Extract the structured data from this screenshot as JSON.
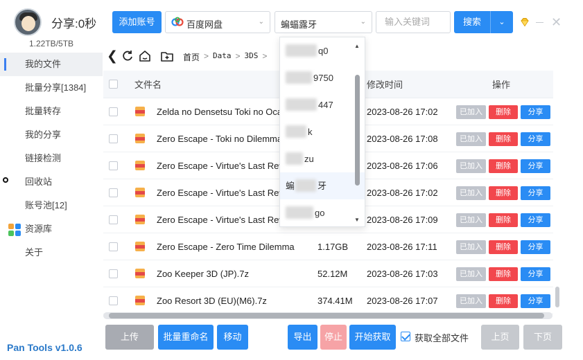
{
  "header": {
    "share_title": "分享:0秒",
    "storage": "1.22TB/5TB",
    "add_account_label": "添加账号",
    "pan_select_value": "百度网盘",
    "account_select_value": "蝙蝠露牙",
    "search_placeholder": "输入关键词",
    "search_label": "搜索"
  },
  "sidebar": {
    "items": [
      {
        "label": "我的文件",
        "active": true
      },
      {
        "label": "批量分享[1384]"
      },
      {
        "label": "批量转存"
      },
      {
        "label": "我的分享"
      },
      {
        "label": "链接检测"
      },
      {
        "label": "回收站"
      },
      {
        "label": "账号池[12]"
      },
      {
        "label": "资源库"
      },
      {
        "label": "关于"
      }
    ],
    "version": "Pan Tools v1.0.6"
  },
  "breadcrumb": {
    "home": "首页",
    "path": [
      "Data",
      "3DS"
    ]
  },
  "table": {
    "headers": {
      "name": "文件名",
      "time": "修改时间",
      "op": "操作"
    },
    "op_labels": {
      "added": "已加入",
      "delete": "删除",
      "share": "分享"
    },
    "rows": [
      {
        "name": "Zelda no Densetsu Toki no Ocarina 3D",
        "size": "",
        "time": "2023-08-26 17:02"
      },
      {
        "name": "Zero Escape - Toki no Dilemma",
        "size": "",
        "time": "2023-08-26 17:08"
      },
      {
        "name": "Zero Escape - Virtue's Last Reward",
        "size": "",
        "time": "2023-08-26 17:06"
      },
      {
        "name": "Zero Escape - Virtue's Last Reward",
        "size": "",
        "time": "2023-08-26 17:02"
      },
      {
        "name": "Zero Escape - Virtue's Last Reward",
        "size": "",
        "time": "2023-08-26 17:09"
      },
      {
        "name": "Zero Escape - Zero Time Dilemma",
        "size": "1.17GB",
        "time": "2023-08-26 17:11"
      },
      {
        "name": "Zoo Keeper 3D (JP).7z",
        "size": "52.12M",
        "time": "2023-08-26 17:03"
      },
      {
        "name": "Zoo Resort 3D (EU)(M6).7z",
        "size": "374.41M",
        "time": "2023-08-26 17:07"
      }
    ]
  },
  "dropdown": {
    "items": [
      {
        "visible_tail": "q0"
      },
      {
        "visible_tail": "9750"
      },
      {
        "visible_tail": "447"
      },
      {
        "visible_tail": "k"
      },
      {
        "visible_tail": "zu"
      },
      {
        "visible_head": "蝙",
        "visible_tail": "牙",
        "highlighted": true
      },
      {
        "visible_tail": "go"
      }
    ]
  },
  "bottom": {
    "upload": "上传",
    "batch_rename": "批量重命名",
    "move": "移动",
    "export": "导出",
    "stop": "停止",
    "start_fetch": "开始获取",
    "fetch_all_label": "获取全部文件",
    "fetch_all_checked": true,
    "prev": "上页",
    "next": "下页"
  },
  "colors": {
    "accent": "#2a8cf4",
    "danger": "#f2474d",
    "disabled": "#c0c4cc",
    "brand_text": "#2a79c9"
  }
}
